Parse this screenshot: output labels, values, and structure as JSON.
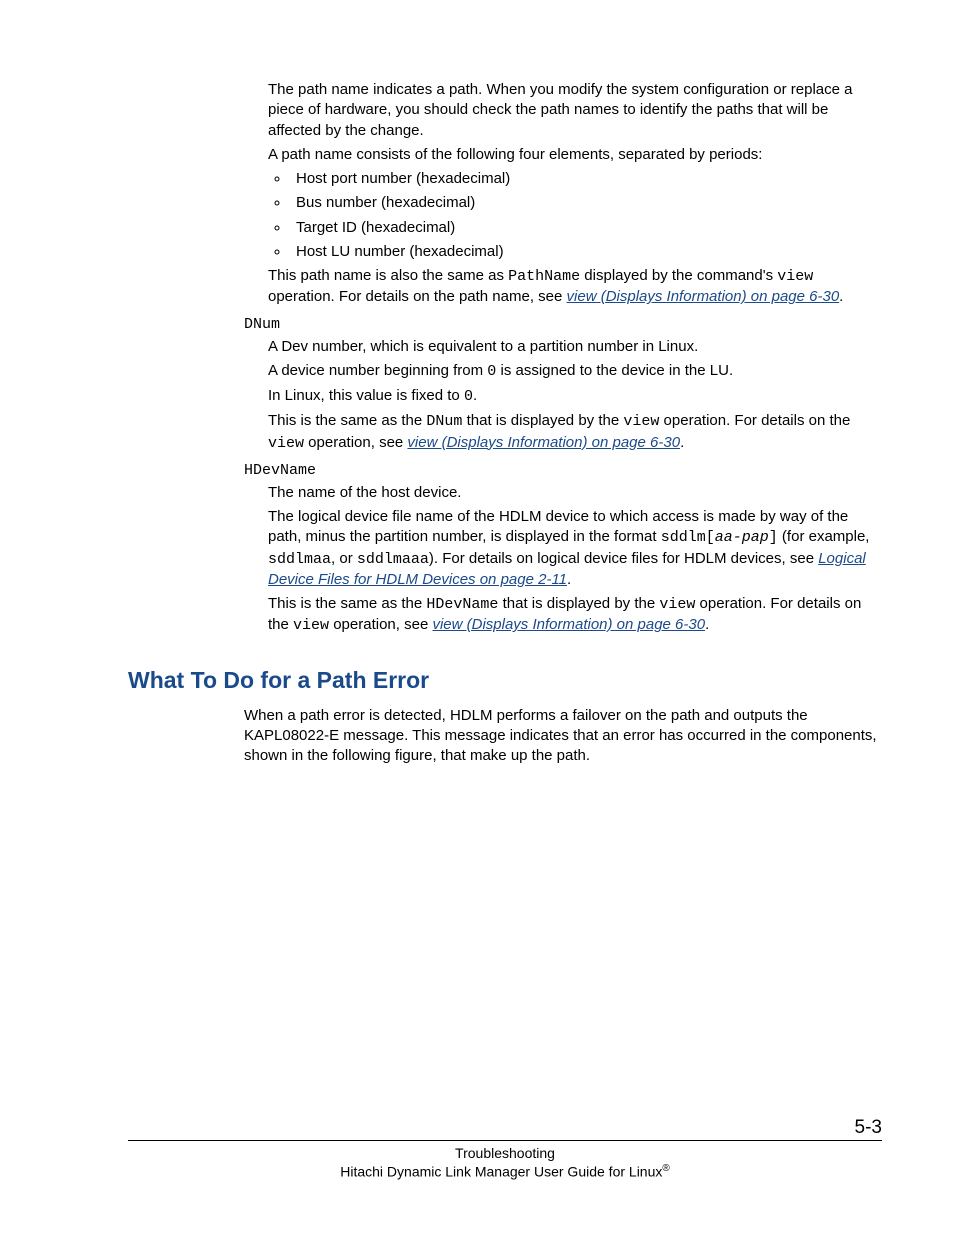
{
  "pathname": {
    "intro1": "The path name indicates a path. When you modify the system configuration or replace a piece of hardware, you should check the path names to identify the paths that will be affected by the change.",
    "intro2": "A path name consists of the following four elements, separated by periods:",
    "bullets": [
      "Host port number (hexadecimal)",
      "Bus number (hexadecimal)",
      "Target ID (hexadecimal)",
      "Host LU number (hexadecimal)"
    ],
    "after1a": "This path name is also the same as ",
    "after1_mono": "PathName",
    "after1b": " displayed by the command's ",
    "after1_mono2": "view",
    "after1c": " operation. For details on the path name, see ",
    "after1_link": "view (Displays Information) on page 6-30",
    "after1d": "."
  },
  "dnum": {
    "term": "DNum",
    "p1": "A Dev number, which is equivalent to a partition number in Linux.",
    "p2a": "A device number beginning from ",
    "p2_mono": "0",
    "p2b": " is assigned to the device in the LU.",
    "p3a": "In Linux, this value is fixed to ",
    "p3_mono": "0",
    "p3b": ".",
    "p4a": "This is the same as the ",
    "p4_mono1": "DNum",
    "p4b": " that is displayed by the ",
    "p4_mono2": "view",
    "p4c": " operation. For details on the ",
    "p4_mono3": "view",
    "p4d": " operation, see ",
    "p4_link": "view (Displays Information) on page 6-30",
    "p4e": "."
  },
  "hdevname": {
    "term": "HDevName",
    "p1": "The name of the host device.",
    "p2a": "The logical device file name of the HDLM device to which access is made by way of the path, minus the partition number, is displayed in the format ",
    "p2_mono1": "sddlm[",
    "p2_italic": "aa-pap",
    "p2_mono1b": "]",
    "p2b": " (for example, ",
    "p2_mono2": "sddlmaa",
    "p2c": ", or ",
    "p2_mono3": "sddlmaaa",
    "p2d": "). For details on logical device files for HDLM devices, see ",
    "p2_link": "Logical Device Files for HDLM Devices on page 2-11",
    "p2e": ".",
    "p3a": "This is the same as the ",
    "p3_mono1": "HDevName",
    "p3b": " that is displayed by the ",
    "p3_mono2": "view",
    "p3c": " operation. For details on the ",
    "p3_mono3": "view",
    "p3d": " operation, see ",
    "p3_link": "view (Displays Information) on page 6-30",
    "p3e": "."
  },
  "heading": "What To Do for a Path Error",
  "section_body": "When a path error is detected, HDLM performs a failover on the path and outputs the KAPL08022-E message. This message indicates that an error has occurred in the components, shown in the following figure, that make up the path.",
  "footer": {
    "section": "Troubleshooting",
    "pagenum": "5-3",
    "doc": "Hitachi Dynamic Link Manager User Guide for Linux"
  }
}
